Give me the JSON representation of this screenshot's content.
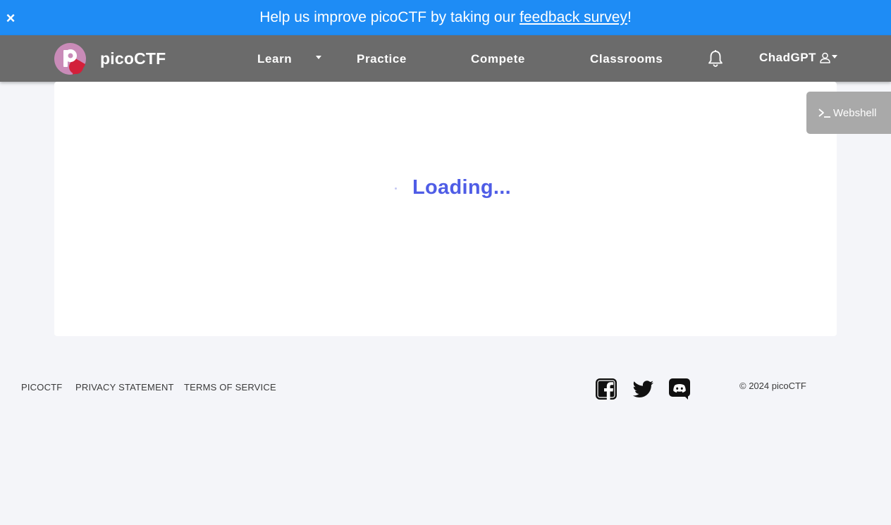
{
  "banner": {
    "text_before": "Help us improve picoCTF by taking our ",
    "link_text": "feedback survey",
    "text_after": "!",
    "close_symbol": "×",
    "color": "#1e8cf5"
  },
  "navbar": {
    "brand": "picoCTF",
    "items": [
      {
        "label": "Learn",
        "has_dropdown": true
      },
      {
        "label": "Practice"
      },
      {
        "label": "Compete"
      },
      {
        "label": "Classrooms"
      }
    ],
    "notifications_icon": "bell-icon",
    "user": {
      "name": "ChadGPT",
      "icon": "user-icon"
    },
    "color": "#6b6b6b"
  },
  "main": {
    "loading_text": "Loading...",
    "accent": "#4f5de6"
  },
  "webshell": {
    "label": "Webshell",
    "icon": "terminal-icon"
  },
  "footer": {
    "links": [
      "PICOCTF",
      "PRIVACY STATEMENT",
      "TERMS OF SERVICE"
    ],
    "social": [
      "facebook-icon",
      "twitter-icon",
      "discord-icon"
    ],
    "copyright": "© 2024 picoCTF"
  }
}
